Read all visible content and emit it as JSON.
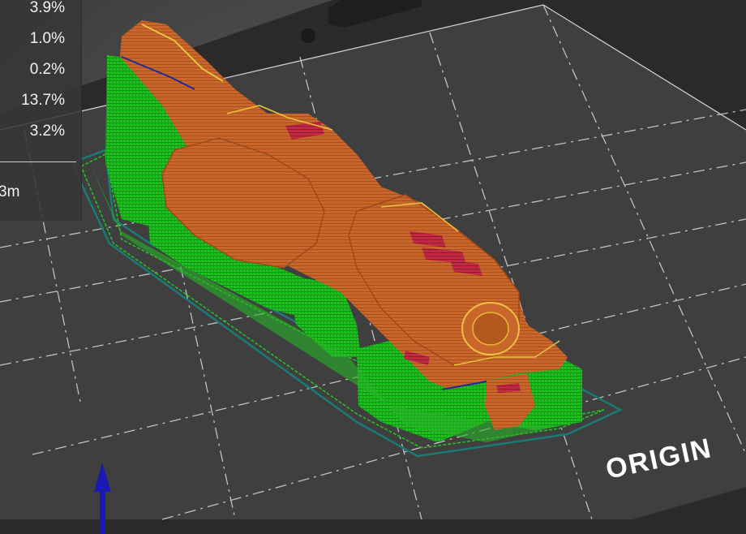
{
  "stats_panel": {
    "feature_percentages": [
      "3.9%",
      "1.0%",
      "0.2%",
      "13.7%",
      "3.2%"
    ],
    "summary_value": "3m"
  },
  "bed": {
    "label": "ORIGIN"
  },
  "colors": {
    "model_perimeter": "#c8662c",
    "support_material": "#1fba1f",
    "skirt_line": "#1c7a74",
    "top_solid_infill": "#c22a44",
    "axis_z": "#1a1ab3",
    "bed_surface": "#3c3c3c",
    "bed_grid": "#d8d8d8"
  },
  "axis": {
    "visible_axis": "z"
  }
}
